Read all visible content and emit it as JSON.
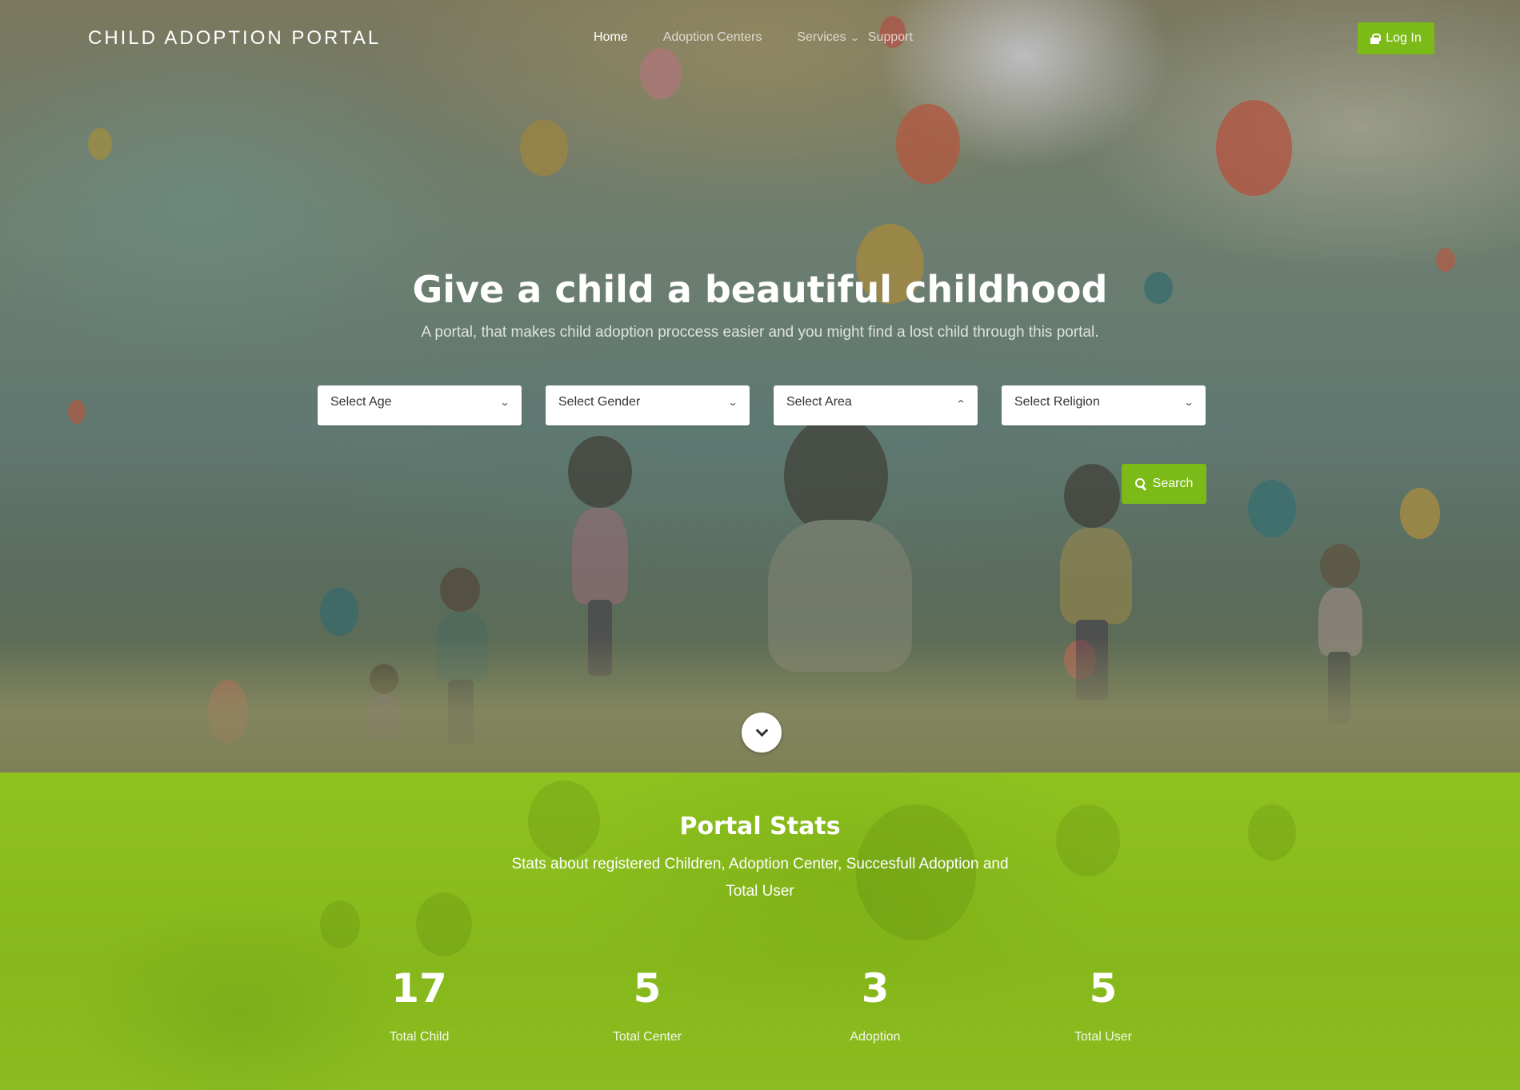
{
  "header": {
    "brand": "CHILD ADOPTION PORTAL",
    "nav": {
      "home": "Home",
      "adoption_centers": "Adoption Centers",
      "services": "Services",
      "support": "Support"
    },
    "login_label": "Log In"
  },
  "hero": {
    "title": "Give a child a beautiful childhood",
    "subtitle": "A portal, that makes child adoption proccess easier and you might find a lost child through this portal.",
    "filters": {
      "age": "Select Age",
      "gender": "Select Gender",
      "area": "Select Area",
      "religion": "Select Religion"
    },
    "search_label": "Search"
  },
  "stats": {
    "title": "Portal Stats",
    "description": "Stats about registered Children, Adoption Center, Succesfull Adoption and Total User",
    "items": [
      {
        "value": "17",
        "label": "Total Child"
      },
      {
        "value": "5",
        "label": "Total Center"
      },
      {
        "value": "3",
        "label": "Adoption"
      },
      {
        "value": "5",
        "label": "Total User"
      }
    ]
  },
  "colors": {
    "accent": "#7cbb17",
    "stats_bg": "#8ec21f"
  },
  "icons": {
    "login": "lock-icon",
    "search": "search-icon",
    "scroll": "chevron-down-icon"
  }
}
